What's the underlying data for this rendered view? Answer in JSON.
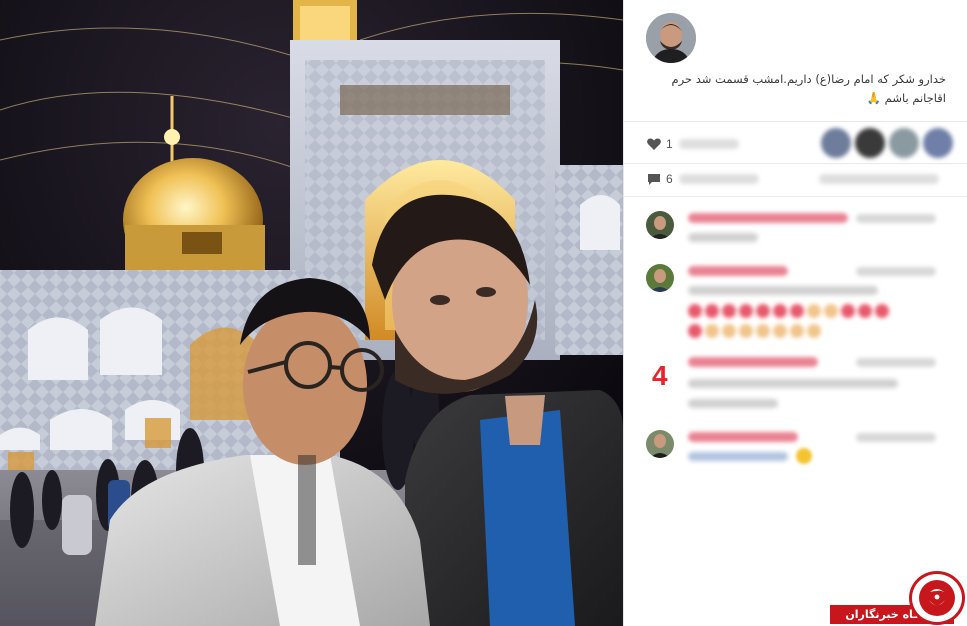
{
  "post": {
    "caption": "خدارو شکر که امام رضا(ع) داریم.امشب قسمت شد حرم اقاجانم باشم 🙏",
    "likes": {
      "visible_count": "1"
    },
    "comments": {
      "visible_count": "6"
    }
  },
  "overlay": {
    "red_number": "4"
  },
  "watermark": {
    "label": "باشگاه خبرنگاران"
  },
  "colors": {
    "accent_red": "#c8161d",
    "comment_user": "#e25a6e"
  },
  "icons": {
    "like": "heart-icon",
    "comment": "speech-bubble-icon"
  }
}
